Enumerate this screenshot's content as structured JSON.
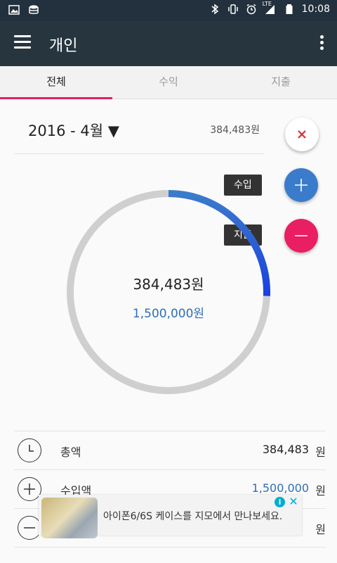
{
  "status_bar": {
    "time": "10:08",
    "network": "LTE",
    "left_icons": [
      "image-icon",
      "database-icon"
    ],
    "right_icons": [
      "bluetooth-icon",
      "vibrate-icon",
      "alarm-icon",
      "signal-icon",
      "battery-icon"
    ]
  },
  "app_bar": {
    "title": "개인"
  },
  "tabs": [
    {
      "label": "전체",
      "active": true
    },
    {
      "label": "수익",
      "active": false
    },
    {
      "label": "지출",
      "active": false
    }
  ],
  "period": {
    "label": "2016 - 4월 ▼",
    "total": "384,483원"
  },
  "actions": {
    "income_label": "수입",
    "expense_label": "지출"
  },
  "donut": {
    "amount": "384,483원",
    "income": "1,500,000원",
    "fraction": 0.256322,
    "colors": {
      "track": "#cfcfcf",
      "start": "#3a7ccb",
      "end": "#1a3fe0"
    }
  },
  "summary": [
    {
      "label": "총액",
      "value": "384,483",
      "unit": "원"
    },
    {
      "label": "수입액",
      "value": "1,500,000",
      "unit": "원"
    },
    {
      "label": "",
      "value": "",
      "unit": "원"
    }
  ],
  "ad": {
    "text": "아이폰6/6S 케이스를 지모에서 만나보세요.",
    "info": "i",
    "close": "✕"
  }
}
